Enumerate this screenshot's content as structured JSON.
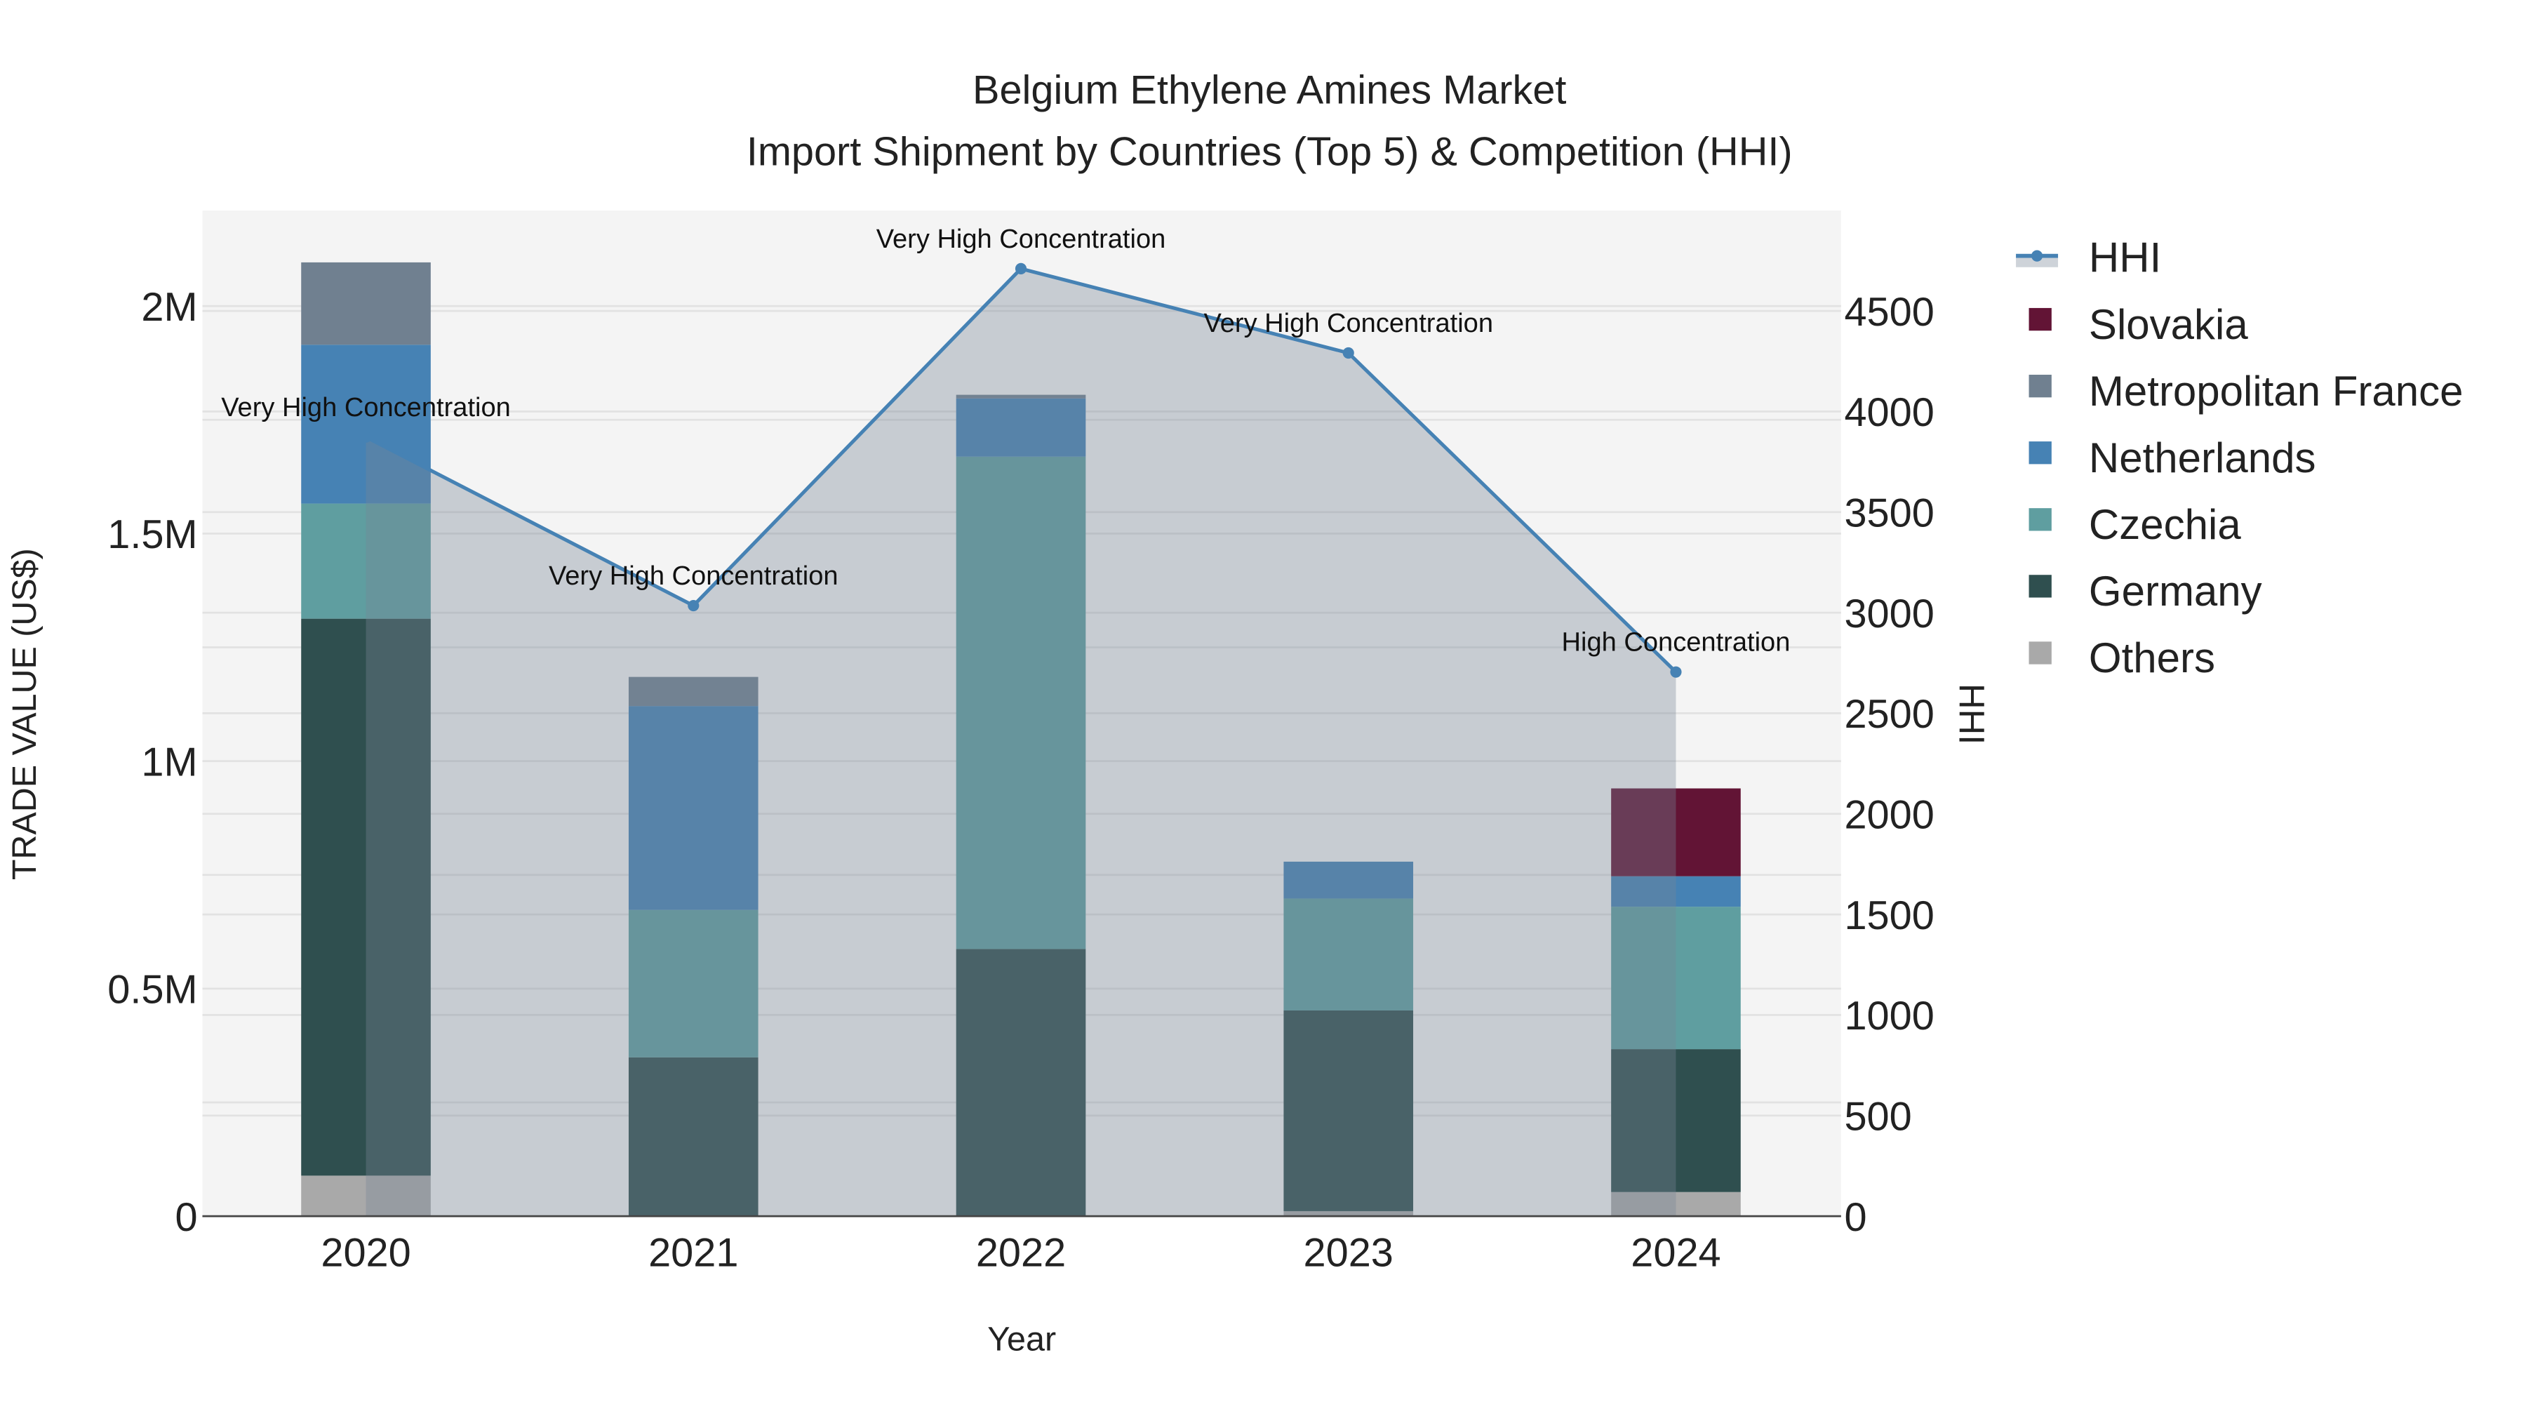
{
  "chart_data": {
    "type": "bar",
    "title_line1": "Belgium Ethylene Amines Market",
    "title_line2": "Import Shipment by Countries (Top 5) & Competition (HHI)",
    "xlabel": "Year",
    "ylabel": "TRADE VALUE (US$)",
    "y2label": "HHI",
    "categories": [
      "2020",
      "2021",
      "2022",
      "2023",
      "2024"
    ],
    "ylim": [
      0,
      2200000
    ],
    "y2lim": [
      0,
      4990
    ],
    "yticks": [
      {
        "v": 0,
        "label": "0"
      },
      {
        "v": 500000,
        "label": "0.5M"
      },
      {
        "v": 1000000,
        "label": "1M"
      },
      {
        "v": 1500000,
        "label": "1.5M"
      },
      {
        "v": 2000000,
        "label": "2M"
      }
    ],
    "y2ticks": [
      0,
      500,
      1000,
      1500,
      2000,
      2500,
      3000,
      3500,
      4000,
      4500
    ],
    "barmode": "stack",
    "series": [
      {
        "name": "Others",
        "color": "#a9a9a9",
        "values": [
          89000,
          0,
          0,
          11000,
          53000
        ]
      },
      {
        "name": "Germany",
        "color": "#2f4f4f",
        "values": [
          1224000,
          349000,
          587000,
          441000,
          314000
        ]
      },
      {
        "name": "Czechia",
        "color": "#5f9ea0",
        "values": [
          253000,
          324000,
          1082000,
          246000,
          313000
        ]
      },
      {
        "name": "Netherlands",
        "color": "#4682b4",
        "values": [
          349000,
          448000,
          128000,
          81000,
          67000
        ]
      },
      {
        "name": "Metropolitan France",
        "color": "#708090",
        "values": [
          181000,
          64000,
          8000,
          0,
          0
        ]
      },
      {
        "name": "Slovakia",
        "color": "#621435",
        "values": [
          0,
          0,
          0,
          0,
          193000
        ]
      }
    ],
    "hhi": {
      "name": "HHI",
      "color": "#4682b4",
      "values": [
        3873,
        3035,
        4710,
        4291,
        2705
      ],
      "annotations": [
        "Very High Concentration",
        "Very High Concentration",
        "Very High Concentration",
        "Very High Concentration",
        "High Concentration"
      ]
    },
    "legend": [
      "HHI",
      "Slovakia",
      "Metropolitan France",
      "Netherlands",
      "Czechia",
      "Germany",
      "Others"
    ],
    "legend_position": "right"
  }
}
